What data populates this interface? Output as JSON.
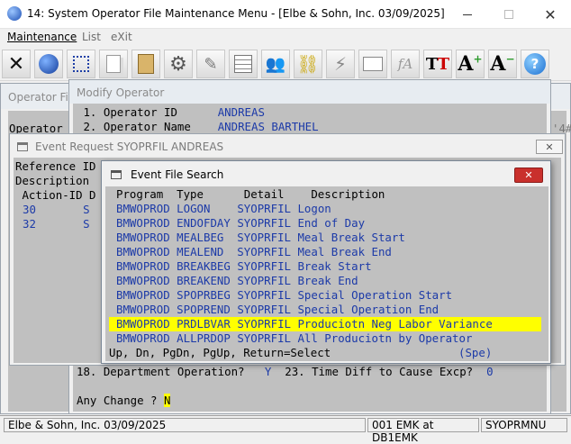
{
  "window": {
    "title": "14: System Operator File Maintenance Menu - [Elbe & Sohn, Inc. 03/09/2025]"
  },
  "menu": {
    "items": [
      {
        "label": "Maintenance"
      },
      {
        "label": "List"
      },
      {
        "label": "eXit"
      }
    ]
  },
  "toolbar": {
    "icons": [
      "exit-x-icon",
      "globe-icon",
      "select-box-icon",
      "copy-pages-icon",
      "clipboard-icon",
      "gear-icon",
      "edit-form-icon",
      "grid-table-icon",
      "users-icon",
      "chain-link-icon",
      "lightning-icon",
      "window-arrow-icon",
      "font-icon",
      "text-tt-icon",
      "font-increase-icon",
      "font-decrease-icon",
      "help-icon"
    ]
  },
  "operator_panel": {
    "header": "Operator Fi",
    "line1": "Operator",
    "right_text": "'4#"
  },
  "modify": {
    "header": "Modify Operator",
    "lines": [
      {
        "num": " 1.",
        "label": "Operator ID",
        "value": "ANDREAS"
      },
      {
        "num": " 2.",
        "label": "Operator Name",
        "value": "ANDREAS BARTHEL"
      }
    ],
    "line18": "18. Department Operation?   ",
    "line18_val": "Y",
    "line23": "  23. Time Diff to Cause Excp?  ",
    "line23_val": "0",
    "prompt": "Any Change ? ",
    "prompt_val": "N"
  },
  "event_request": {
    "title": "Event Request SYOPRFIL ANDREAS",
    "ref_label": "Reference ID",
    "desc_label": "Description",
    "col_header": " Action-ID D",
    "rows": [
      {
        "id": "30",
        "code": "S"
      },
      {
        "id": "32",
        "code": "S"
      }
    ]
  },
  "event_search": {
    "title": "Event File Search",
    "header": "Program  Type      Detail    Description",
    "rows": [
      {
        "program": "BMWOPROD",
        "type": "LOGON",
        "detail": "SYOPRFIL",
        "desc": "Logon"
      },
      {
        "program": "BMWOPROD",
        "type": "ENDOFDAY",
        "detail": "SYOPRFIL",
        "desc": "End of Day"
      },
      {
        "program": "BMWOPROD",
        "type": "MEALBEG",
        "detail": "SYOPRFIL",
        "desc": "Meal Break Start"
      },
      {
        "program": "BMWOPROD",
        "type": "MEALEND",
        "detail": "SYOPRFIL",
        "desc": "Meal Break End"
      },
      {
        "program": "BMWOPROD",
        "type": "BREAKBEG",
        "detail": "SYOPRFIL",
        "desc": "Break Start"
      },
      {
        "program": "BMWOPROD",
        "type": "BREAKEND",
        "detail": "SYOPRFIL",
        "desc": "Break End"
      },
      {
        "program": "BMWOPROD",
        "type": "SPOPRBEG",
        "detail": "SYOPRFIL",
        "desc": "Special Operation Start"
      },
      {
        "program": "BMWOPROD",
        "type": "SPOPREND",
        "detail": "SYOPRFIL",
        "desc": "Special Operation End"
      },
      {
        "program": "BMWOPROD",
        "type": "PRDLBVAR",
        "detail": "SYOPRFIL",
        "desc": "Produciotn Neg Labor Variance"
      },
      {
        "program": "BMWOPROD",
        "type": "ALLPRDOP",
        "detail": "SYOPRFIL",
        "desc": "All Produciotn by Operator"
      }
    ],
    "selected_index": 8,
    "footer": "Up, Dn, PgDn, PgUp, Return=Select",
    "footer_right": "(Spe)"
  },
  "status": {
    "left": "Elbe & Sohn, Inc. 03/09/2025",
    "mid": "001 EMK at DB1EMK",
    "right": "SYOPRMNU"
  },
  "colors": {
    "highlight": "#ffff00",
    "field_blue": "#1c3aa8",
    "close_red": "#c9302c"
  }
}
